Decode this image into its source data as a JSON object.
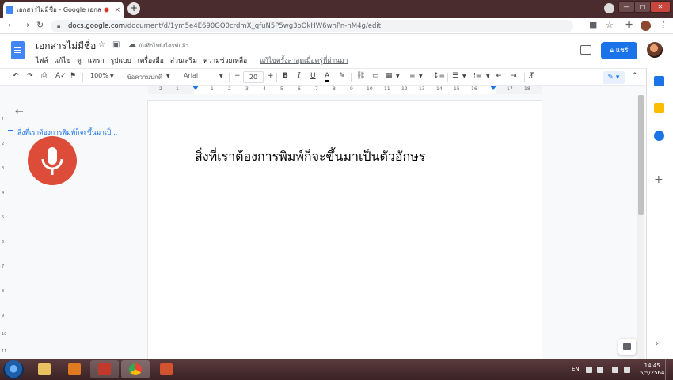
{
  "browser": {
    "tab_title": "เอกสารไม่มีชื่อ - Google เอกส",
    "tab_close": "×",
    "new_tab": "+",
    "window_buttons": [
      "—",
      "□",
      "✕"
    ],
    "url_host": "docs.google.com",
    "url_path": "/document/d/1ym5e4E690GQ0crdmX_qfuN5P5wg3oOkHW6whPn-nM4g/edit",
    "nav_icons": [
      "back-icon",
      "forward-icon",
      "reload-icon",
      "lock-icon",
      "camera-icon",
      "bookmark-star-icon",
      "extensions-icon",
      "avatar",
      "menu-icon"
    ]
  },
  "docs_header": {
    "title": "เอกสารไม่มีชื่อ",
    "save_status": "บันทึกไปยังไดรฟ์แล้ว",
    "menu": [
      "ไฟล์",
      "แก้ไข",
      "ดู",
      "แทรก",
      "รูปแบบ",
      "เครื่องมือ",
      "ส่วนเสริม",
      "ความช่วยเหลือ"
    ],
    "last_edit": "แก้ไขครั้งล่าสุดเมื่อครู่ที่ผ่านมา",
    "share_label": "แชร์",
    "share_icon": "lock-icon"
  },
  "toolbar": {
    "zoom": "100%",
    "style": "ข้อความปกติ",
    "font": "Arial",
    "font_size": "20",
    "bold": "B",
    "italic": "I",
    "underline": "U",
    "text_color": "A",
    "clear": "T̸",
    "edit_mode_icon": "pencil-icon"
  },
  "ruler": {
    "numbers": [
      "2",
      "1",
      "1",
      "2",
      "3",
      "4",
      "5",
      "6",
      "7",
      "8",
      "9",
      "10",
      "11",
      "12",
      "13",
      "14",
      "15",
      "16",
      "17",
      "18"
    ]
  },
  "vertical_ruler": {
    "numbers": [
      "1",
      "2",
      "3",
      "4",
      "5",
      "6",
      "7",
      "8",
      "9",
      "10",
      "11"
    ]
  },
  "outline": {
    "item": "สิ่งที่เราต้องการพิมพ์ก็จะขึ้นมาเป็...",
    "back_icon": "arrow-left-icon"
  },
  "voice_typing": {
    "icon": "microphone-icon",
    "color": "#dd4b39"
  },
  "document": {
    "text_before_caret": "สิ่งที่เราต้องการ",
    "text_after_caret": "พิมพ์ก็จะขึ้นมาเป็นตัวอักษร"
  },
  "side_panel": {
    "icons": [
      "calendar-icon",
      "keep-icon",
      "tasks-icon",
      "add-icon",
      "expand-icon"
    ]
  },
  "taskbar": {
    "apps": [
      "explorer-icon",
      "media-player-icon",
      "snipping-icon",
      "chrome-icon",
      "presentation-icon"
    ],
    "lang": "EN",
    "time": "14:45",
    "date": "5/5/2564"
  },
  "colors": {
    "accent": "#1a73e8",
    "mic": "#dd4b39",
    "chrome_frame": "#4a2b2e"
  }
}
